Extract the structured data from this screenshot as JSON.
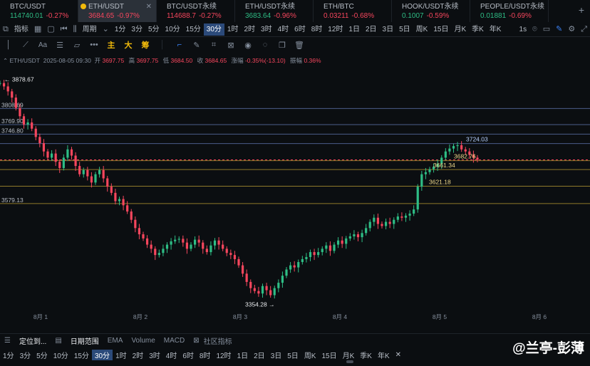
{
  "tickers": [
    {
      "name": "BTC/USDT",
      "price": "114740.01",
      "change": "-0.27%",
      "price_color": "green",
      "active": false
    },
    {
      "name": "ETH/USDT",
      "price": "3684.65",
      "change": "-0.97%",
      "price_color": "red",
      "active": true
    },
    {
      "name": "BTC/USDT永续",
      "price": "114688.7",
      "change": "-0.27%",
      "price_color": "red",
      "active": false
    },
    {
      "name": "ETH/USDT永续",
      "price": "3683.64",
      "change": "-0.96%",
      "price_color": "green",
      "active": false
    },
    {
      "name": "ETH/BTC",
      "price": "0.03211",
      "change": "-0.68%",
      "price_color": "red",
      "active": false
    },
    {
      "name": "HOOK/USDT永续",
      "price": "0.1007",
      "change": "-0.59%",
      "price_color": "green",
      "active": false
    },
    {
      "name": "PEOPLE/USDT永续",
      "price": "0.01881",
      "change": "-0.69%",
      "price_color": "green",
      "active": false
    }
  ],
  "toolbar": {
    "indicator_label": "指标",
    "period_label": "周期",
    "intervals": [
      "1分",
      "3分",
      "5分",
      "10分",
      "15分",
      "30分",
      "1时",
      "2时",
      "3时",
      "4时",
      "6时",
      "8时",
      "12时",
      "1日",
      "2日",
      "3日",
      "5日",
      "周K",
      "15日",
      "月K",
      "季K",
      "年K"
    ],
    "selected_interval": "30分",
    "right_label": "1s"
  },
  "drawbar": {
    "main_label": "主",
    "sub_label": "大",
    "chip_label": "筹",
    "text_tool": "Aa"
  },
  "info": {
    "symbol": "ETH/USDT",
    "datetime": "2025-08-05 09:30",
    "open_label": "开",
    "open": "3697.75",
    "high_label": "高",
    "high": "3697.75",
    "low_label": "低",
    "low": "3684.50",
    "close_label": "收",
    "close": "3684.65",
    "change_label": "涨幅",
    "change": "-0.35%(-13.10)",
    "amp_label": "振幅",
    "amp": "0.36%"
  },
  "chart_data": {
    "type": "candlestick",
    "price_range": [
      3340,
      3885
    ],
    "high_marker": "3878.67",
    "low_marker": "3354.28",
    "annotations": [
      "3724.03",
      "3682.76",
      "3661.34",
      "3621.18"
    ],
    "x_labels": [
      "8月 1",
      "8月 2",
      "8月 3",
      "8月 4",
      "8月 5",
      "8月 6"
    ],
    "x_label_positions": [
      1,
      2,
      3,
      4,
      5,
      6
    ],
    "levels": [
      {
        "price": 3808.69,
        "label": "3808.69",
        "color": "#4b5d8a"
      },
      {
        "price": 3769.9,
        "label": "3769.90",
        "color": "#4b5d8a"
      },
      {
        "price": 3746.8,
        "label": "3746.80",
        "color": "#4b5d8a"
      },
      {
        "price": 3724.03,
        "label": "",
        "color": "#4b5d8a"
      },
      {
        "price": 3684.65,
        "label": "",
        "color": "#f6465d",
        "dashed": true
      },
      {
        "price": 3682.76,
        "label": "",
        "color": "#8f7a2a"
      },
      {
        "price": 3661.34,
        "label": "",
        "color": "#8f7a2a"
      },
      {
        "price": 3621.18,
        "label": "",
        "color": "#8f7a2a"
      },
      {
        "price": 3579.13,
        "label": "3579.13",
        "color": "#8f7a2a"
      }
    ],
    "candle_count": 122,
    "path": [
      3870,
      3862,
      3850,
      3835,
      3810,
      3790,
      3770,
      3775,
      3760,
      3740,
      3725,
      3705,
      3690,
      3700,
      3680,
      3665,
      3690,
      3710,
      3695,
      3670,
      3650,
      3660,
      3645,
      3630,
      3650,
      3660,
      3640,
      3620,
      3605,
      3585,
      3590,
      3575,
      3560,
      3540,
      3520,
      3505,
      3495,
      3480,
      3470,
      3455,
      3460,
      3470,
      3480,
      3488,
      3492,
      3494,
      3485,
      3470,
      3480,
      3492,
      3485,
      3470,
      3462,
      3478,
      3490,
      3480,
      3470,
      3460,
      3455,
      3445,
      3430,
      3410,
      3390,
      3375,
      3368,
      3362,
      3380,
      3370,
      3358,
      3375,
      3388,
      3405,
      3420,
      3430,
      3425,
      3438,
      3445,
      3450,
      3462,
      3455,
      3462,
      3470,
      3478,
      3465,
      3480,
      3490,
      3482,
      3495,
      3500,
      3505,
      3498,
      3508,
      3520,
      3535,
      3545,
      3530,
      3525,
      3535,
      3530,
      3540,
      3548,
      3545,
      3550,
      3555,
      3565,
      3620,
      3650,
      3655,
      3662,
      3668,
      3675,
      3690,
      3705,
      3712,
      3718,
      3720,
      3710,
      3705,
      3697,
      3690,
      3685
    ]
  },
  "indicators": {
    "locate_label": "定位到...",
    "range_label": "日期范围",
    "ema": "EMA",
    "volume": "Volume",
    "macd": "MACD",
    "community": "社区指标"
  },
  "bottom_intervals": [
    "1分",
    "3分",
    "5分",
    "10分",
    "15分",
    "30分",
    "1时",
    "2时",
    "3时",
    "4时",
    "6时",
    "8时",
    "12时",
    "1日",
    "2日",
    "3日",
    "5日",
    "周K",
    "15日",
    "月K",
    "季K",
    "年K"
  ],
  "watermark": "@兰亭-彭薄"
}
